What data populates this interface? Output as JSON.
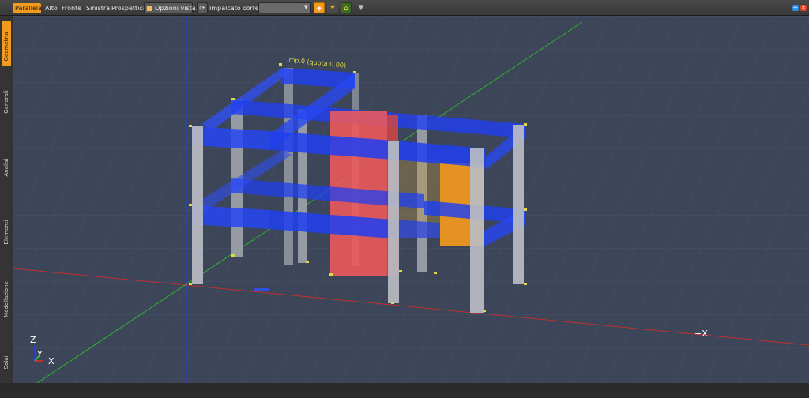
{
  "toolbar": {
    "view_tabs": [
      "Parallela",
      "Alto",
      "Fronte",
      "Sinistra",
      "Prospettica"
    ],
    "view_options_label": "Opzioni vista...",
    "current_floor_label": "Impalcato corrente:",
    "current_floor_value": ""
  },
  "side_tabs": [
    "Geometria",
    "Generali",
    "Analisi",
    "Elementi",
    "Modellazione",
    "Solai"
  ],
  "viewport": {
    "level_label": "Imp.0 (quota 0.00)",
    "axis_x_label": "+X",
    "gizmo_labels": {
      "z": "Z",
      "y": "Y",
      "x": "X"
    }
  },
  "colors": {
    "accent": "#f29a1e",
    "beam": "#1f3ff0",
    "column": "#b8b8b8",
    "wall": "#f04a4a",
    "panel": "#f29a1e",
    "axis_x": "#c0302e",
    "axis_y": "#2fb42f",
    "axis_z": "#2a3fd8"
  },
  "icons": [
    "orbit-icon",
    "lock-icon",
    "wrench-icon",
    "home-icon",
    "pin-icon",
    "add-icon",
    "close-icon"
  ]
}
